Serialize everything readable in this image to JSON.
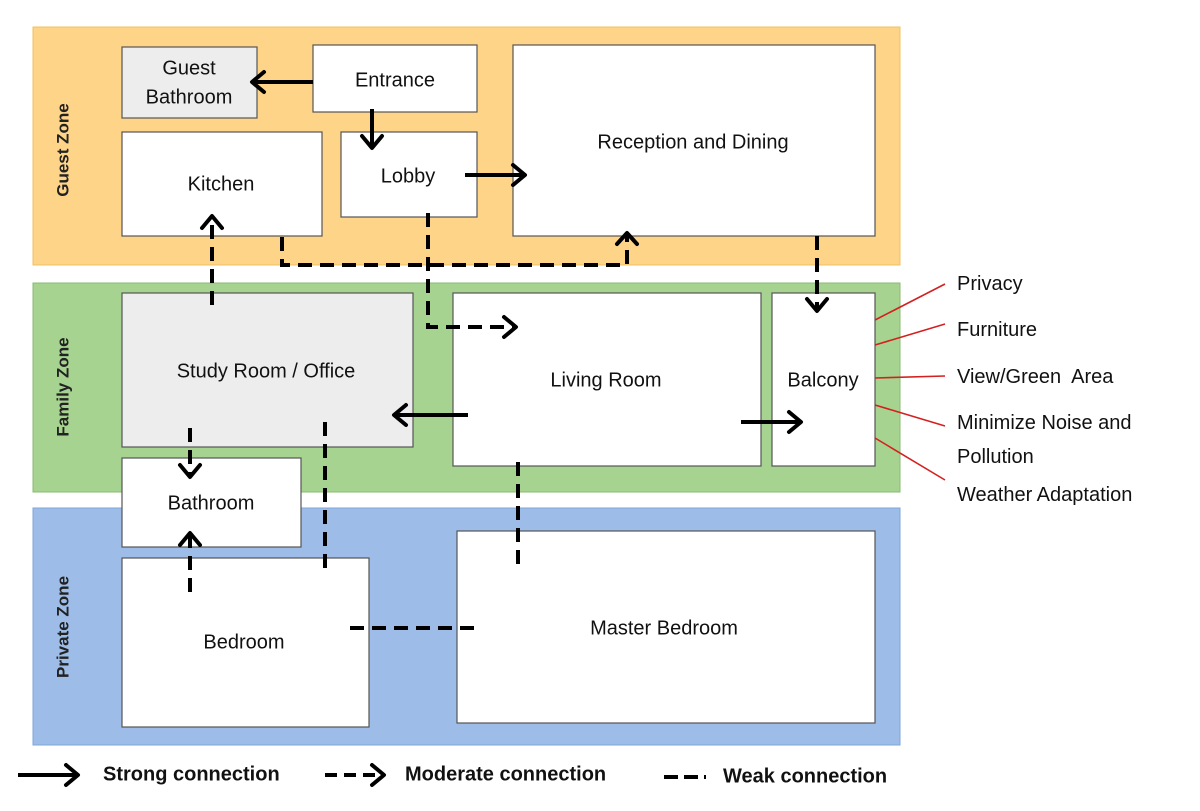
{
  "zones": {
    "guest": {
      "label": "Guest Zone",
      "color": "#fdd488"
    },
    "family": {
      "label": "Family Zone",
      "color": "#a6d38f"
    },
    "private": {
      "label": "Private Zone",
      "color": "#9dbde8"
    }
  },
  "rooms": {
    "guest_bathroom": [
      "Guest",
      "Bathroom"
    ],
    "entrance": "Entrance",
    "kitchen": "Kitchen",
    "lobby": "Lobby",
    "reception": "Reception and Dining",
    "study": "Study Room / Office",
    "living": "Living Room",
    "balcony": "Balcony",
    "bathroom": "Bathroom",
    "bedroom": "Bedroom",
    "master": "Master Bedroom"
  },
  "balcony_factors": [
    "Privacy",
    "Furniture",
    "View/Green  Area",
    "Minimize Noise and",
    "Pollution",
    "Weather Adaptation"
  ],
  "legend": {
    "strong": "Strong connection",
    "moderate": "Moderate connection",
    "weak": "Weak connection"
  },
  "colors": {
    "factor_line": "#d42020",
    "gray_room": "#ededed"
  }
}
